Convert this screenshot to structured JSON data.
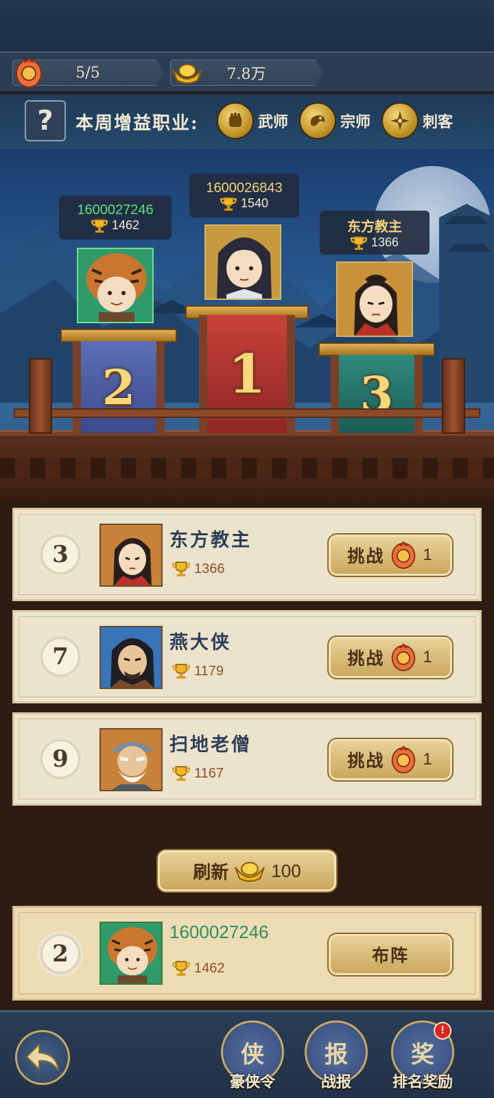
{
  "resources": {
    "tickets": "5/5",
    "gold": "7.8万"
  },
  "buff": {
    "label": "本周增益职业:",
    "classes": [
      {
        "name": "武师",
        "icon": "fist-icon"
      },
      {
        "name": "宗师",
        "icon": "dragon-icon"
      },
      {
        "name": "刺客",
        "icon": "shuriken-icon"
      }
    ]
  },
  "podium": {
    "first": {
      "rank": "1",
      "name": "1600026843",
      "score": "1540"
    },
    "second": {
      "rank": "2",
      "name": "1600027246",
      "score": "1462"
    },
    "third": {
      "rank": "3",
      "name": "东方教主",
      "score": "1366"
    }
  },
  "opponents": [
    {
      "rank": "3",
      "name": "东方教主",
      "score": "1366",
      "action": "挑战",
      "cost": "1"
    },
    {
      "rank": "7",
      "name": "燕大侠",
      "score": "1179",
      "action": "挑战",
      "cost": "1"
    },
    {
      "rank": "9",
      "name": "扫地老僧",
      "score": "1167",
      "action": "挑战",
      "cost": "1"
    }
  ],
  "refresh": {
    "label": "刷新",
    "cost": "100"
  },
  "me": {
    "rank": "2",
    "name": "1600027246",
    "score": "1462",
    "action": "布阵"
  },
  "nav": {
    "items": [
      {
        "label": "豪侠令",
        "glyph": "侠"
      },
      {
        "label": "战报",
        "glyph": "报"
      },
      {
        "label": "排名奖励",
        "glyph": "奖",
        "badge": "!"
      }
    ]
  },
  "colors": {
    "podium_first": "#c8413c",
    "podium_second": "#5d6fb6",
    "podium_third": "#2f8a7c",
    "my_name": "#2f8e5a",
    "second_tag_name": "#5fe07a",
    "first_tag_name": "#f4d27a",
    "third_tag_name": "#f4d27a"
  }
}
